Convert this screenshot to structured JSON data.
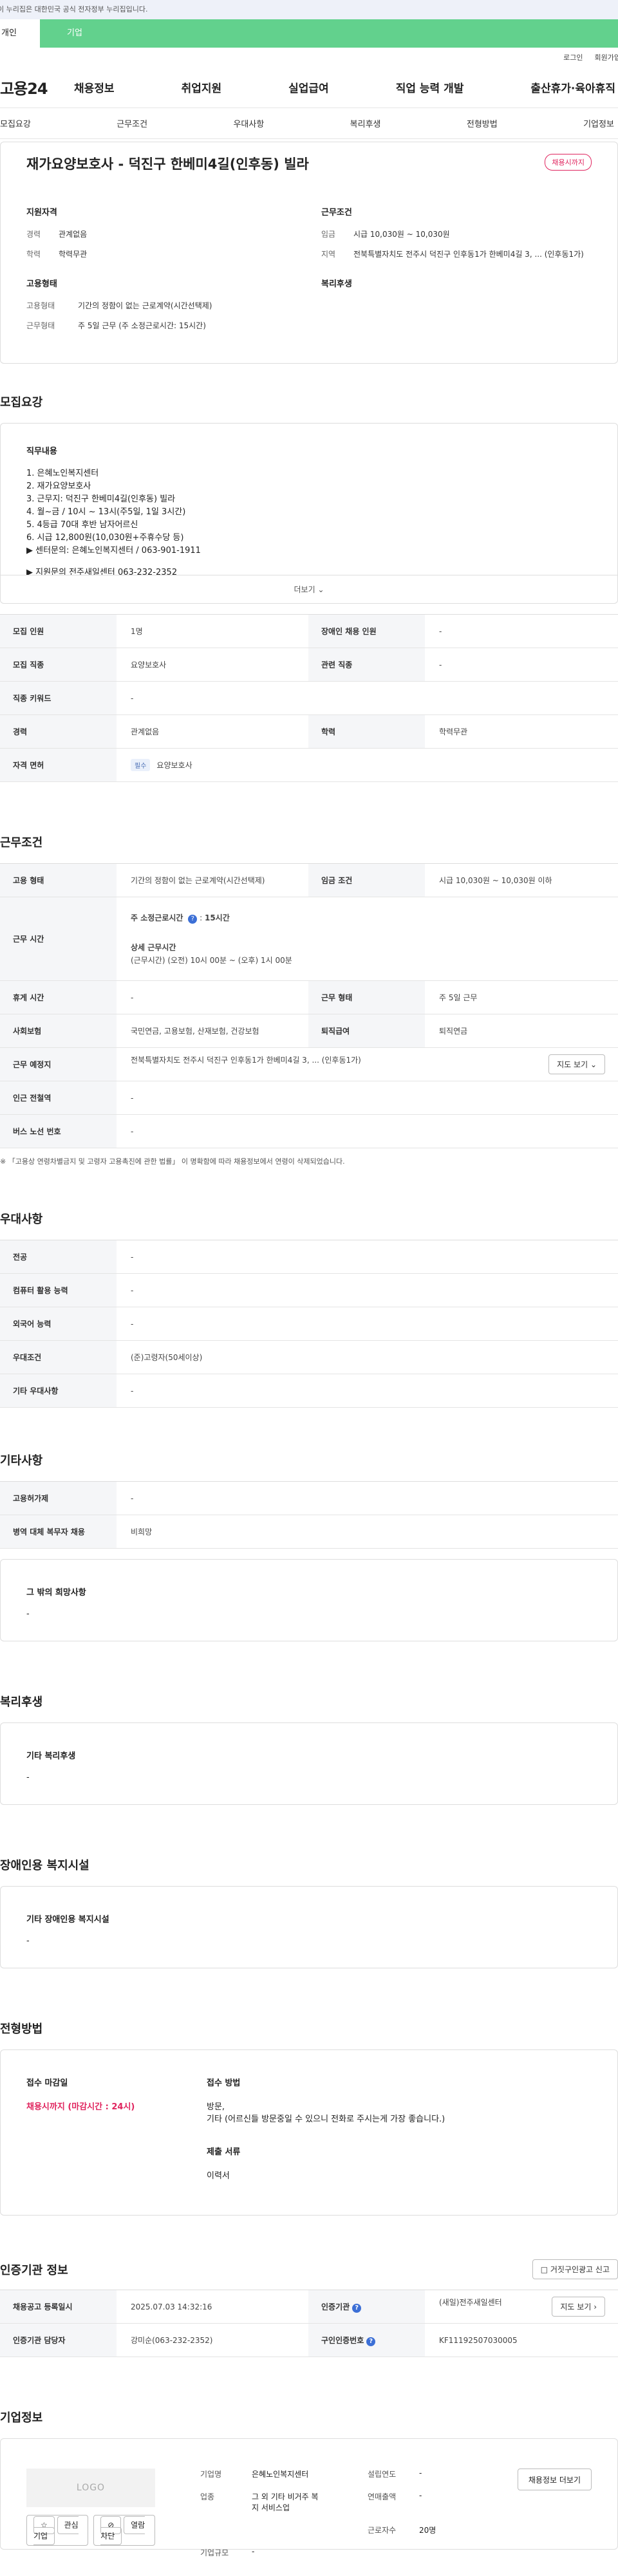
{
  "gov_banner": "이 누리집은 대한민국 공식 전자정부 누리집입니다.",
  "top_tabs": {
    "individual": "개인",
    "company": "기업"
  },
  "util": {
    "login": "로그인",
    "signup": "회원가입"
  },
  "gnb": {
    "logo": "고용24",
    "menu": [
      "채용정보",
      "취업지원",
      "실업급여",
      "직업 능력 개발",
      "출산휴가·육아휴직"
    ]
  },
  "anchors": [
    "모집요강",
    "근무조건",
    "우대사항",
    "복리후생",
    "전형방법",
    "기업정보"
  ],
  "summary": {
    "title": "재가요양보호사 - 덕진구 한베미4길(인후동) 빌라",
    "badge": "채용시까지",
    "qual": {
      "heading": "지원자격",
      "career_k": "경력",
      "career_v": "관계없음",
      "edu_k": "학력",
      "edu_v": "학력무관"
    },
    "work": {
      "heading": "근무조건",
      "wage_k": "임금",
      "wage_v": "시급 10,030원 ~ 10,030원",
      "region_k": "지역",
      "region_v": "전북특별자치도 전주시 덕진구 인후동1가 한베미4길 3, ... (인후동1가)"
    },
    "emp": {
      "heading": "고용형태",
      "type_k": "고용형태",
      "type_v": "기간의 정함이 없는 근로계약(시간선택제)",
      "form_k": "근무형태",
      "form_v": "주 5일 근무 (주 소정근로시간: 15시간)"
    },
    "welfare": {
      "heading": "복리후생"
    }
  },
  "recruit": {
    "section_title": "모집요강",
    "desc_heading": "직무내용",
    "desc_lines": [
      "1. 은혜노인복지센터",
      "2. 재가요양보호사",
      "3. 근무지: 덕진구 한베미4길(인후동) 빌라",
      "4. 월~금 / 10시 ~ 13시(주5일, 1일 3시간)",
      "5. 4등급 70대 후반 남자어르신",
      "6. 시급 12,800원(10,030원+주휴수당 등)",
      "▶ 센터문의: 은혜노인복지센터 / 063-901-1911",
      "",
      "▶ 지원문의 전주새일센터 063-232-2352"
    ],
    "more_label": "더보기",
    "rows": {
      "headcount_k": "모집 인원",
      "headcount_v": "1명",
      "disabled_k": "장애인 채용 인원",
      "disabled_v": "-",
      "job_k": "모집 직종",
      "job_v": "요양보호사",
      "related_k": "관련 직종",
      "related_v": "-",
      "keyword_k": "직종 키워드",
      "keyword_v": "-",
      "career_k": "경력",
      "career_v": "관계없음",
      "edu_k": "학력",
      "edu_v": "학력무관",
      "license_k": "자격 면허",
      "license_pill": "필수",
      "license_v": "요양보호사"
    }
  },
  "work": {
    "section_title": "근무조건",
    "type_k": "고용 형태",
    "type_v": "기간의 정함이 없는 근로계약(시간선택제)",
    "wage_k": "임금 조건",
    "wage_v": "시급 10,030원 ~ 10,030원 이하",
    "hours_k": "근무 시간",
    "hours_week_label": "주 소정근로시간",
    "hours_week_value": "15시간",
    "hours_detail_label": "상세 근무시간",
    "hours_detail_value": "(근무시간) (오전) 10시 00분 ~ (오후) 1시 00분",
    "rest_k": "휴게 시간",
    "rest_v": "-",
    "form_k": "근무 형태",
    "form_v": "주 5일 근무",
    "insurance_k": "사회보험",
    "insurance_v": "국민연금, 고용보험, 산재보험, 건강보험",
    "retire_k": "퇴직급여",
    "retire_v": "퇴직연금",
    "place_k": "근무 예정지",
    "place_v": "전북특별자치도 전주시 덕진구 인후동1가 한베미4길 3, ... (인후동1가)",
    "map_btn": "지도 보기",
    "station_k": "인근 전철역",
    "station_v": "-",
    "bus_k": "버스 노선 번호",
    "bus_v": "-",
    "note": "※ 「고용상 연령차별금지 및 고령자 고용촉진에 관한 법률」 이 명확함에 따라 채용정보에서 연령이 삭제되었습니다."
  },
  "prefer": {
    "section_title": "우대사항",
    "major_k": "전공",
    "major_v": "-",
    "pc_k": "컴퓨터 활용 능력",
    "pc_v": "-",
    "lang_k": "외국어 능력",
    "lang_v": "-",
    "cond_k": "우대조건",
    "cond_v": "(준)고령자(50세이상)",
    "etc_k": "기타 우대사항",
    "etc_v": "-"
  },
  "other": {
    "section_title": "기타사항",
    "ins_k": "고용허가제",
    "ins_v": "-",
    "mil_k": "병역 대체 복무자 채용",
    "mil_v": "비희망",
    "wish_h": "그 밖의 희망사항",
    "wish_v": "-"
  },
  "welfare": {
    "section_title": "복리후생",
    "h": "기타 복리후생",
    "v": "-"
  },
  "disab": {
    "section_title": "장애인용 복지시설",
    "h": "기타 장애인용 복지시설",
    "v": "-"
  },
  "process": {
    "section_title": "전형방법",
    "deadline_h": "접수 마감일",
    "deadline_v": "채용시까지 (마감시간 : 24시)",
    "method_h": "접수 방법",
    "method_v1": "방문,",
    "method_v2": "기타 (어르신들 방문중일 수 있으니 전화로 주시는게 가장 좋습니다.)",
    "docs_h": "제출 서류",
    "docs_v": "이력서"
  },
  "agency": {
    "section_title": "인증기관 정보",
    "report_btn": "거짓구인광고 신고",
    "reg_k": "채용공고 등록일시",
    "reg_v": "2025.07.03 14:32:16",
    "org_k": "인증기관",
    "org_v": "(새일)전주새일센터",
    "map_btn": "지도 보기",
    "mgr_k": "인증기관 담당자",
    "mgr_v": "강미순(063-232-2352)",
    "no_k": "구인인증번호",
    "no_v": "KF11192507030005"
  },
  "company": {
    "section_title": "기업정보",
    "logo": "LOGO",
    "fav_btn": "관심기업",
    "block_btn": "열람차단",
    "name_k": "기업명",
    "name_v": "은혜노인복지센터",
    "year_k": "설립연도",
    "year_v": "-",
    "biz_k": "업종",
    "biz_v": "그 외 기타 비거주 복지 서비스업",
    "sales_k": "연매출액",
    "sales_v": "-",
    "emp_k": "근로자수",
    "emp_v": "20명",
    "size_k": "기업규모",
    "size_v": "-",
    "more_btn": "채용정보 더보기"
  },
  "colors": {
    "accent_green": "#62d18d",
    "badge_red": "#e0245e",
    "help_blue": "#3c6fd6"
  }
}
